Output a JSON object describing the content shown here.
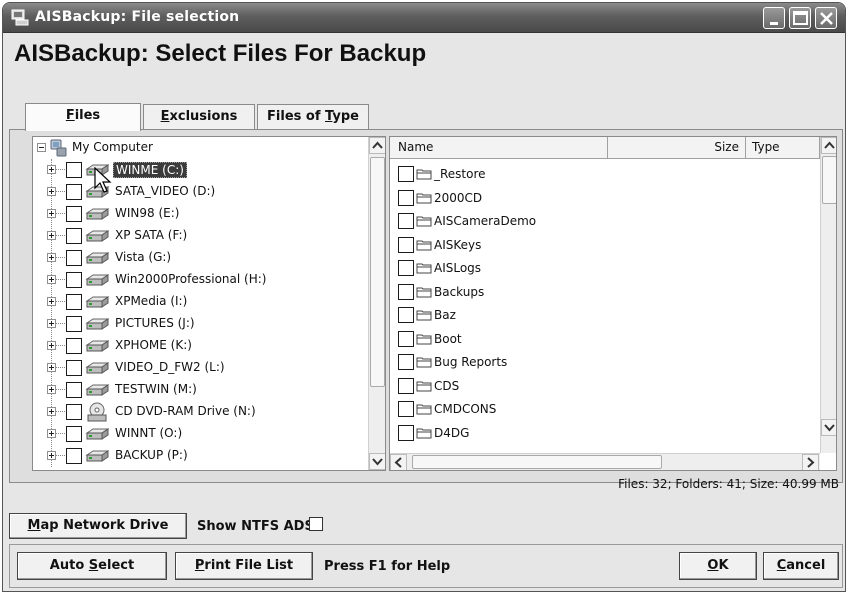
{
  "window": {
    "title": "AISBackup: File selection"
  },
  "heading": "AISBackup: Select Files For Backup",
  "tabs": [
    {
      "pre": "",
      "key": "F",
      "post": "iles"
    },
    {
      "pre": "",
      "key": "E",
      "post": "xclusions"
    },
    {
      "pre": "Files of ",
      "key": "T",
      "post": "ype"
    }
  ],
  "tree": {
    "root": "My Computer",
    "drives": [
      {
        "label": "WINME (C:)",
        "selected": true
      },
      {
        "label": "SATA_VIDEO (D:)"
      },
      {
        "label": "WIN98 (E:)"
      },
      {
        "label": "XP SATA (F:)"
      },
      {
        "label": "Vista (G:)"
      },
      {
        "label": "Win2000Professional (H:)"
      },
      {
        "label": "XPMedia (I:)"
      },
      {
        "label": "PICTURES (J:)"
      },
      {
        "label": "XPHOME (K:)"
      },
      {
        "label": "VIDEO_D_FW2 (L:)"
      },
      {
        "label": "TESTWIN (M:)"
      },
      {
        "label": "CD DVD-RAM Drive (N:)",
        "icon": "cd-drive-icon"
      },
      {
        "label": "WINNT (O:)"
      },
      {
        "label": "BACKUP (P:)"
      }
    ]
  },
  "file_list": {
    "columns": [
      "Name",
      "Size",
      "Type"
    ],
    "folders": [
      "_Restore",
      "2000CD",
      "AISCameraDemo",
      "AISKeys",
      "AISLogs",
      "Backups",
      "Baz",
      "Boot",
      "Bug Reports",
      "CDS",
      "CMDCONS",
      "D4DG"
    ]
  },
  "status": "Files: 32;  Folders: 41;  Size: 40.99 MB",
  "map_network": {
    "key": "M",
    "post": "ap Network Drive"
  },
  "show_ntfs": "Show NTFS ADS",
  "auto_select": {
    "pre": "Auto ",
    "key": "S",
    "post": "elect"
  },
  "print_list": {
    "key": "P",
    "post": "rint File List"
  },
  "help_text": "Press F1 for Help",
  "ok": {
    "key": "O",
    "post": "K"
  },
  "cancel": {
    "key": "C",
    "post": "ancel"
  }
}
